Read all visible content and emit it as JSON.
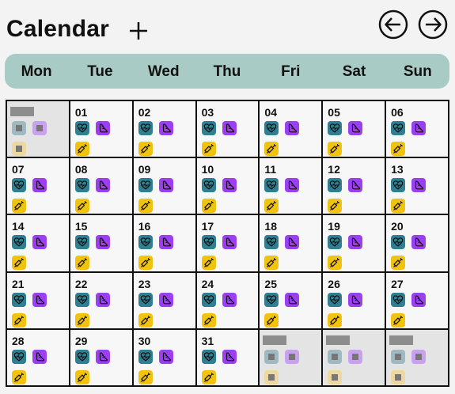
{
  "header": {
    "title": "Calendar"
  },
  "weekdays": [
    "Mon",
    "Tue",
    "Wed",
    "Thu",
    "Fri",
    "Sat",
    "Sun"
  ],
  "cells": [
    {
      "day": "",
      "dim": true
    },
    {
      "day": "01"
    },
    {
      "day": "02"
    },
    {
      "day": "03"
    },
    {
      "day": "04"
    },
    {
      "day": "05"
    },
    {
      "day": "06"
    },
    {
      "day": "07"
    },
    {
      "day": "08"
    },
    {
      "day": "09"
    },
    {
      "day": "10"
    },
    {
      "day": "11"
    },
    {
      "day": "12"
    },
    {
      "day": "13"
    },
    {
      "day": "14"
    },
    {
      "day": "15"
    },
    {
      "day": "16"
    },
    {
      "day": "17"
    },
    {
      "day": "18"
    },
    {
      "day": "19"
    },
    {
      "day": "20"
    },
    {
      "day": "21"
    },
    {
      "day": "22"
    },
    {
      "day": "23"
    },
    {
      "day": "24"
    },
    {
      "day": "25"
    },
    {
      "day": "26"
    },
    {
      "day": "27"
    },
    {
      "day": "28"
    },
    {
      "day": "29"
    },
    {
      "day": "30"
    },
    {
      "day": "31"
    },
    {
      "day": "",
      "dim": true
    },
    {
      "day": "",
      "dim": true
    },
    {
      "day": "",
      "dim": true
    }
  ],
  "icons": {
    "teal": "heart-pulse-icon",
    "purple": "shoe-icon",
    "yellow": "syringe-icon"
  },
  "colors": {
    "weekbar": "#a9cbc5",
    "teal": "#2f7f92",
    "purple": "#9b3ff0",
    "yellow": "#f1c30f"
  }
}
